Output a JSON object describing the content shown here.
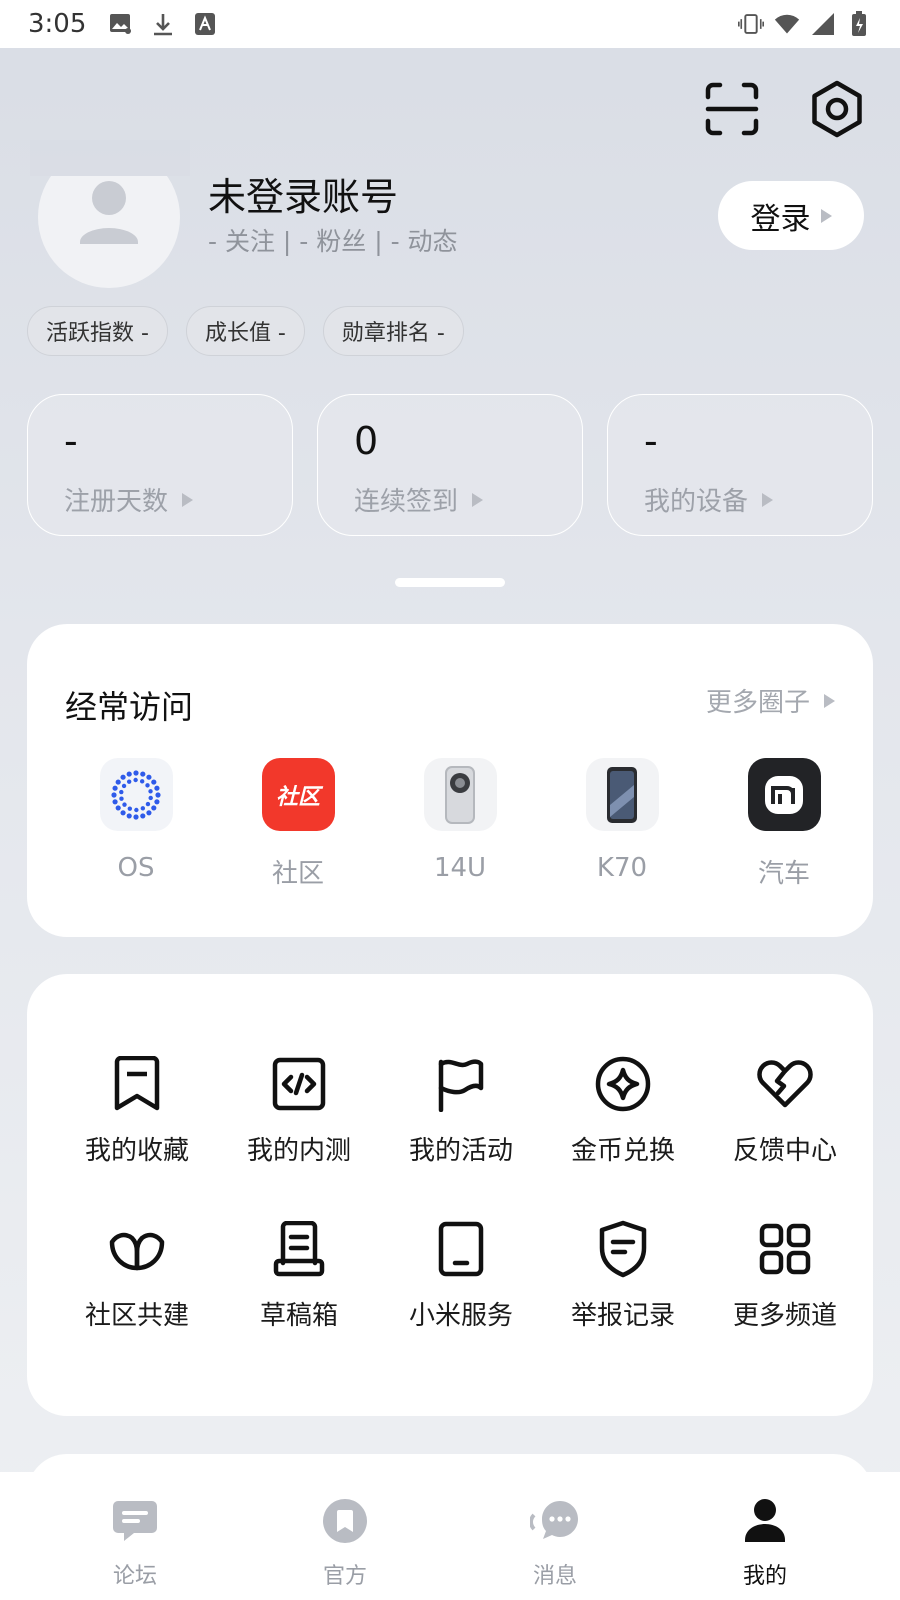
{
  "status_bar": {
    "time": "3:05",
    "left_icons": [
      "gallery-notification-icon",
      "download-icon",
      "text-notification-icon"
    ],
    "right_icons": [
      "vibrate-icon",
      "wifi-icon",
      "signal-icon",
      "battery-icon"
    ]
  },
  "top_actions": {
    "scan_icon": "scan-icon",
    "settings_icon": "settings-icon"
  },
  "profile": {
    "name": "未登录账号",
    "stats": "- 关注 | - 粉丝 | - 动态",
    "login_label": "登录"
  },
  "chips": [
    {
      "label": "活跃指数 -"
    },
    {
      "label": "成长值 -"
    },
    {
      "label": "勋章排名 -"
    }
  ],
  "stat_cards": [
    {
      "value": "-",
      "label": "注册天数"
    },
    {
      "value": "0",
      "label": "连续签到"
    },
    {
      "value": "-",
      "label": "我的设备"
    }
  ],
  "frequent": {
    "title": "经常访问",
    "more": "更多圈子",
    "items": [
      {
        "label": "OS",
        "icon": "os-icon"
      },
      {
        "label": "社区",
        "icon": "community-icon",
        "icon_text": "社区",
        "color": "#f2382b"
      },
      {
        "label": "14U",
        "icon": "phone-14u-icon"
      },
      {
        "label": "K70",
        "icon": "phone-k70-icon"
      },
      {
        "label": "汽车",
        "icon": "mi-car-icon"
      }
    ]
  },
  "menu": [
    {
      "label": "我的收藏",
      "icon": "bookmark-icon"
    },
    {
      "label": "我的内测",
      "icon": "code-icon"
    },
    {
      "label": "我的活动",
      "icon": "flag-icon"
    },
    {
      "label": "金币兑换",
      "icon": "coin-star-icon"
    },
    {
      "label": "反馈中心",
      "icon": "heart-icon"
    },
    {
      "label": "社区共建",
      "icon": "leaf-icon"
    },
    {
      "label": "草稿箱",
      "icon": "draft-icon"
    },
    {
      "label": "小米服务",
      "icon": "tablet-icon"
    },
    {
      "label": "举报记录",
      "icon": "shield-icon"
    },
    {
      "label": "更多频道",
      "icon": "grid-icon"
    }
  ],
  "bottom_nav": [
    {
      "label": "论坛",
      "icon": "forum-icon"
    },
    {
      "label": "官方",
      "icon": "official-icon"
    },
    {
      "label": "消息",
      "icon": "message-icon"
    },
    {
      "label": "我的",
      "icon": "person-icon",
      "active": true
    }
  ],
  "colors": {
    "accent_red": "#f2382b",
    "os_blue": "#2f5bea",
    "text_primary": "#111111",
    "text_secondary": "#9a9ea6"
  }
}
